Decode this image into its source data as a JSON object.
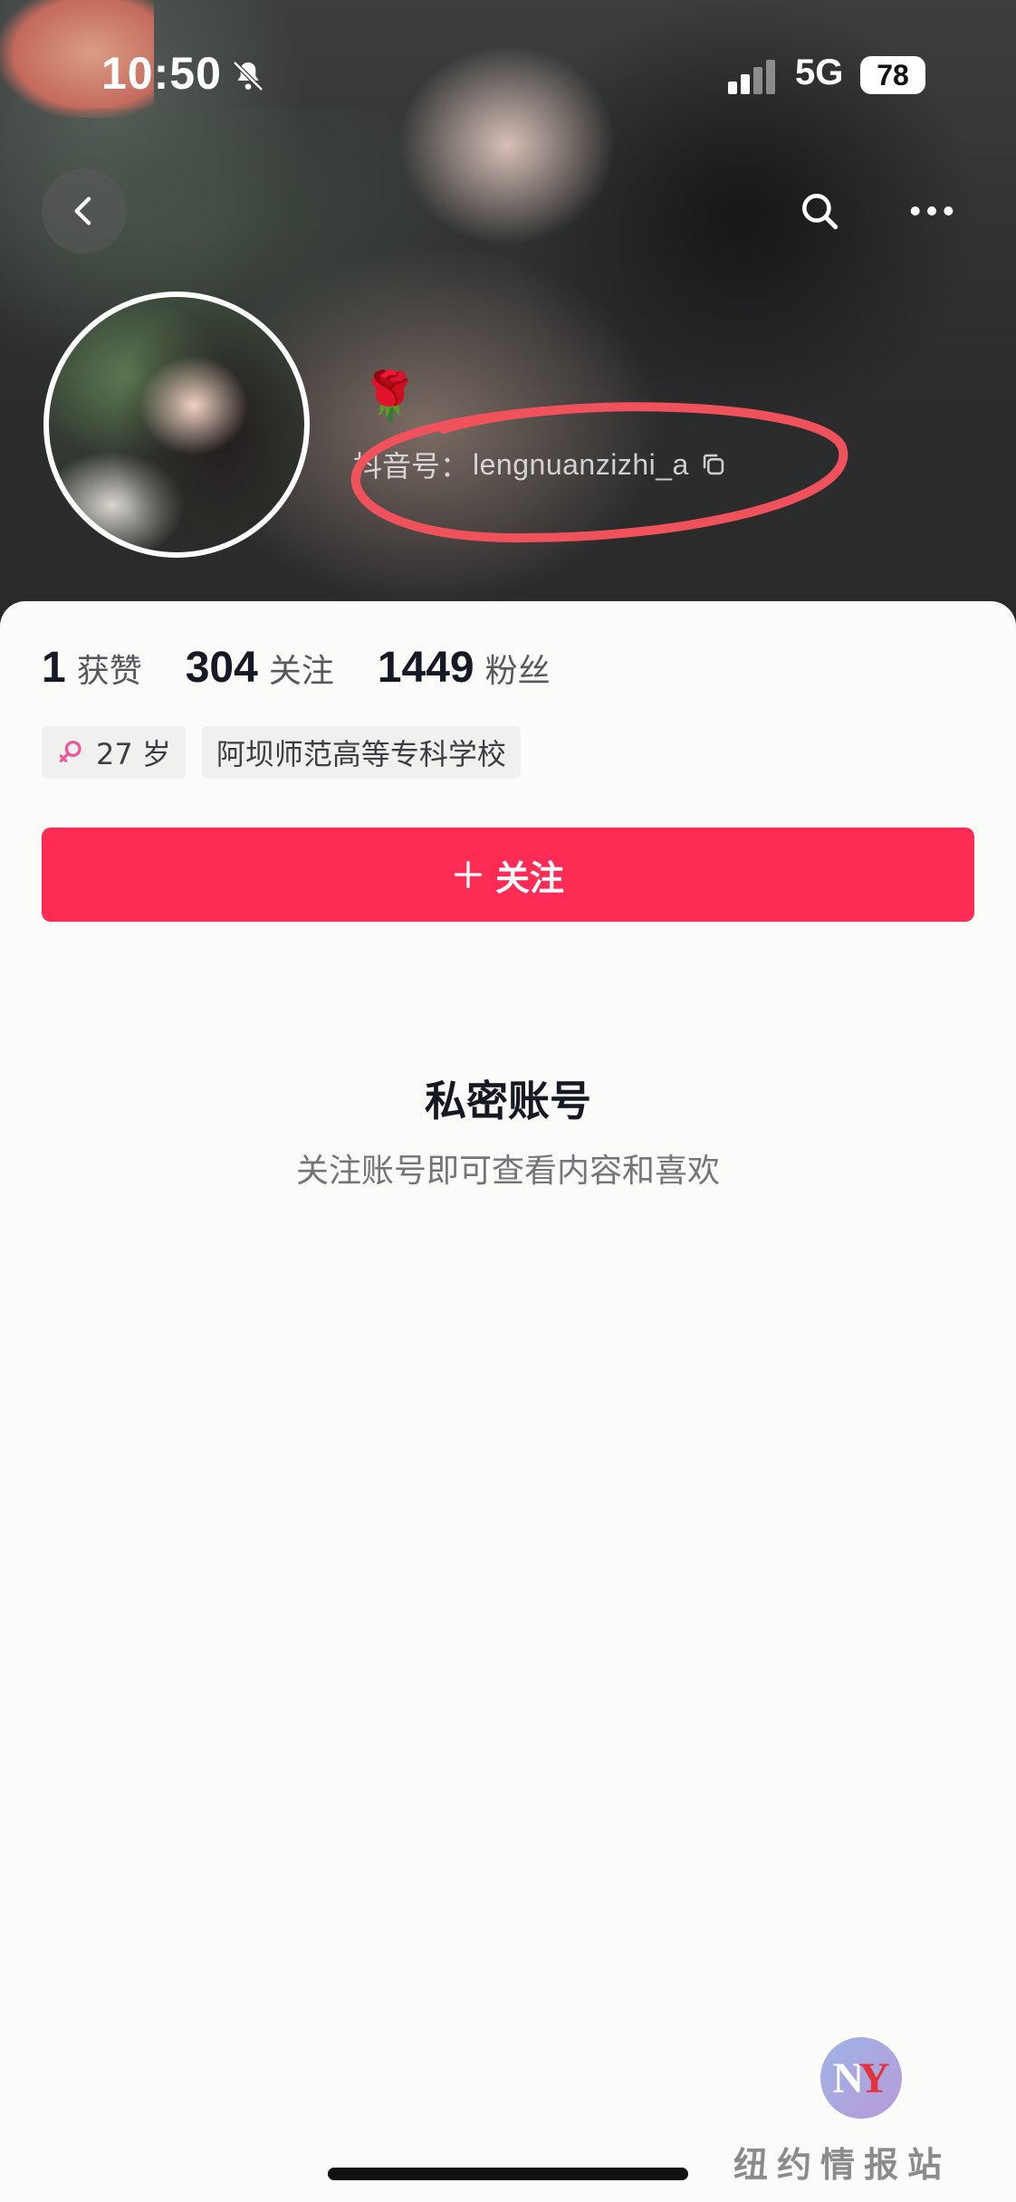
{
  "status_bar": {
    "time": "10:50",
    "network": "5G",
    "battery": "78"
  },
  "toolbar": {
    "back_icon": "chevron-left-icon",
    "search_icon": "search-icon",
    "more_icon": "more-horizontal-icon"
  },
  "profile": {
    "emoji": "🌹",
    "douyin_id_label": "抖音号：",
    "douyin_id": "lengnuanzizhi_a"
  },
  "stats": [
    {
      "number": "1",
      "label": "获赞"
    },
    {
      "number": "304",
      "label": "关注"
    },
    {
      "number": "1449",
      "label": "粉丝"
    }
  ],
  "tags": {
    "age": "27 岁",
    "school": "阿坝师范高等专科学校"
  },
  "follow_button": {
    "label": "关注"
  },
  "private": {
    "title": "私密账号",
    "subtitle": "关注账号即可查看内容和喜欢"
  },
  "watermark": {
    "logo": "NY",
    "text": "纽约情报站"
  },
  "colors": {
    "accent": "#fe2c55",
    "highlight_circle": "#f0525c"
  }
}
